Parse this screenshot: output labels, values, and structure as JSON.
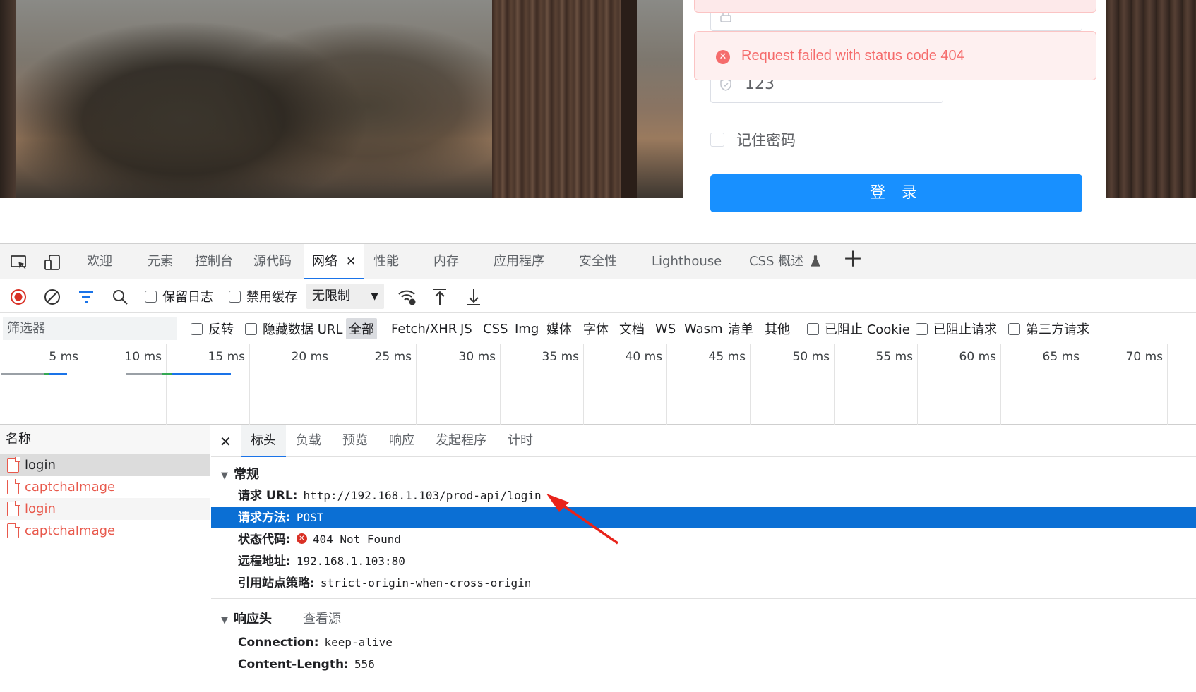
{
  "login": {
    "password_mask": "•••••••••",
    "error_message": "Request failed with status code 404",
    "captcha_value": "123",
    "remember_label": "记住密码",
    "login_button": "登 录"
  },
  "devtools": {
    "tabs": [
      "欢迎",
      "元素",
      "控制台",
      "源代码",
      "网络",
      "性能",
      "内存",
      "应用程序",
      "安全性",
      "Lighthouse",
      "CSS 概述"
    ],
    "toolbar": {
      "preserve_log": "保留日志",
      "disable_cache": "禁用缓存",
      "throttling": "无限制"
    },
    "filter": {
      "placeholder": "筛选器",
      "invert": "反转",
      "hide_data_url": "隐藏数据 URL",
      "types": [
        "全部",
        "Fetch/XHR",
        "JS",
        "CSS",
        "Img",
        "媒体",
        "字体",
        "文档",
        "WS",
        "Wasm",
        "清单",
        "其他"
      ],
      "blocked_cookies": "已阻止 Cookie",
      "blocked_requests": "已阻止请求",
      "third_party": "第三方请求"
    },
    "timeline_ticks": [
      "5 ms",
      "10 ms",
      "15 ms",
      "20 ms",
      "25 ms",
      "30 ms",
      "35 ms",
      "40 ms",
      "45 ms",
      "50 ms",
      "55 ms",
      "60 ms",
      "65 ms",
      "70 ms"
    ],
    "requests": {
      "header": "名称",
      "items": [
        "login",
        "captchaImage",
        "login",
        "captchaImage"
      ]
    },
    "details": {
      "tabs": [
        "标头",
        "负载",
        "预览",
        "响应",
        "发起程序",
        "计时"
      ],
      "general_title": "常规",
      "general": {
        "url_key": "请求 URL:",
        "url_val": "http://192.168.1.103/prod-api/login",
        "method_key": "请求方法:",
        "method_val": "POST",
        "status_key": "状态代码:",
        "status_val": "404 Not Found",
        "remote_key": "远程地址:",
        "remote_val": "192.168.1.103:80",
        "referrer_key": "引用站点策略:",
        "referrer_val": "strict-origin-when-cross-origin"
      },
      "response_title": "响应头",
      "view_source": "查看源",
      "response_headers": {
        "connection_key": "Connection:",
        "connection_val": "keep-alive",
        "length_key": "Content-Length:",
        "length_val": "556"
      }
    }
  },
  "colors": {
    "error": "#f56c6c",
    "primary": "#1890ff",
    "selection": "#0b6fd4",
    "annotation_arrow": "#e8231a"
  }
}
